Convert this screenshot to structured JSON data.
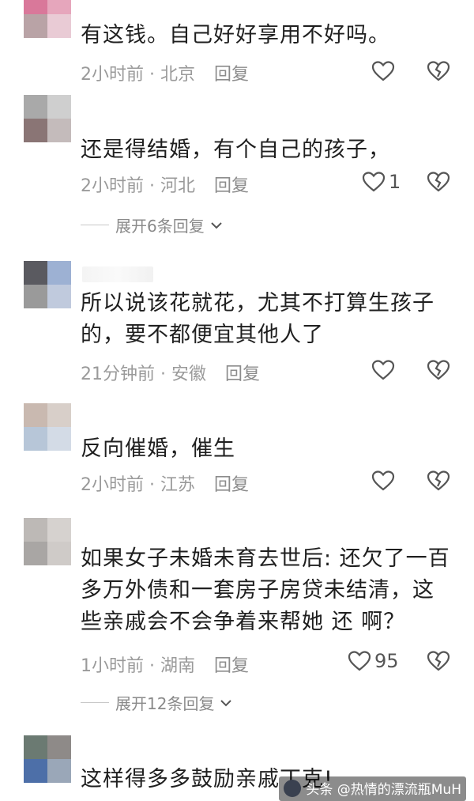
{
  "comments": [
    {
      "text": "有这钱。自己好好享用不好吗。",
      "time": "2小时前",
      "location": "北京",
      "reply": "回复",
      "likes": ""
    },
    {
      "text": "还是得结婚，有个自己的孩子，",
      "time": "2小时前",
      "location": "河北",
      "reply": "回复",
      "likes": "1",
      "expand": "展开6条回复"
    },
    {
      "text": "所以说该花就花，尤其不打算生孩子的，要不都便宜其他人了",
      "time": "21分钟前",
      "location": "安徽",
      "reply": "回复",
      "likes": ""
    },
    {
      "text": "反向催婚，催生",
      "time": "2小时前",
      "location": "江苏",
      "reply": "回复",
      "likes": ""
    },
    {
      "text": "如果女子未婚未育去世后: 还欠了一百多万外债和一套房子房贷未结清，这些亲戚会不会争着来帮她 还 啊？",
      "time": "1小时前",
      "location": "湖南",
      "reply": "回复",
      "likes": "95",
      "expand": "展开12条回复"
    },
    {
      "text": "这样得多多鼓励亲戚丁克!",
      "time": "",
      "location": "",
      "reply": "",
      "likes": ""
    }
  ],
  "meta_separator": "·",
  "watermark": "头条 @热情的漂流瓶MuH",
  "icons": {
    "like": "heart-outline-icon",
    "dislike": "broken-heart-icon",
    "expand": "chevron-down-icon",
    "watermark_logo": "avatar-logo-icon"
  }
}
